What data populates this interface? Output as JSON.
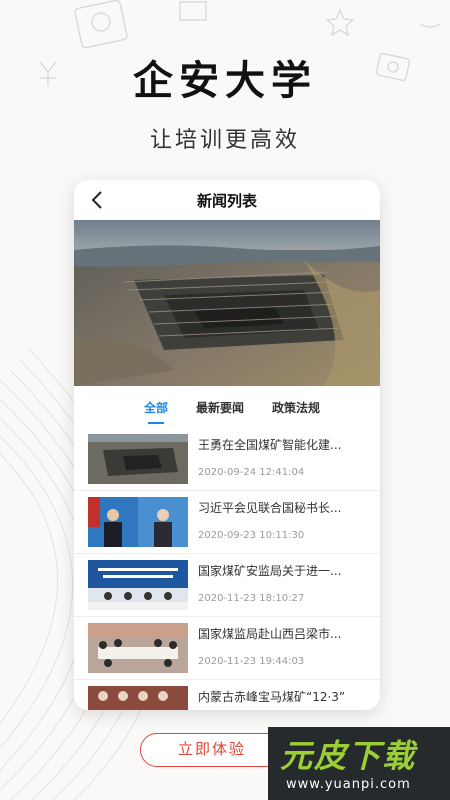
{
  "app": {
    "title": "企安大学",
    "slogan": "让培训更高效"
  },
  "screen": {
    "title": "新闻列表"
  },
  "tabs": [
    {
      "label": "全部",
      "active": true
    },
    {
      "label": "最新要闻",
      "active": false
    },
    {
      "label": "政策法规",
      "active": false
    }
  ],
  "news": [
    {
      "title": "王勇在全国煤矿智能化建...",
      "time": "2020-09-24 12:41:04"
    },
    {
      "title": "习近平会见联合国秘书长...",
      "time": "2020-09-23 10:11:30"
    },
    {
      "title": "国家煤矿安监局关于进一...",
      "time": "2020-11-23 18:10:27"
    },
    {
      "title": "国家煤监局赴山西吕梁市...",
      "time": "2020-11-23 19:44:03"
    },
    {
      "title": "内蒙古赤峰宝马煤矿“12·3”",
      "time": ""
    }
  ],
  "cta": {
    "label": "立即体验"
  },
  "watermark": {
    "big": "元皮下载",
    "small": "www.yuanpi.com"
  },
  "colors": {
    "accent": "#1e88e5",
    "cta": "#e0463a",
    "watermark_green": "#9bd034"
  },
  "icons": {
    "back": "chevron-left-icon"
  }
}
